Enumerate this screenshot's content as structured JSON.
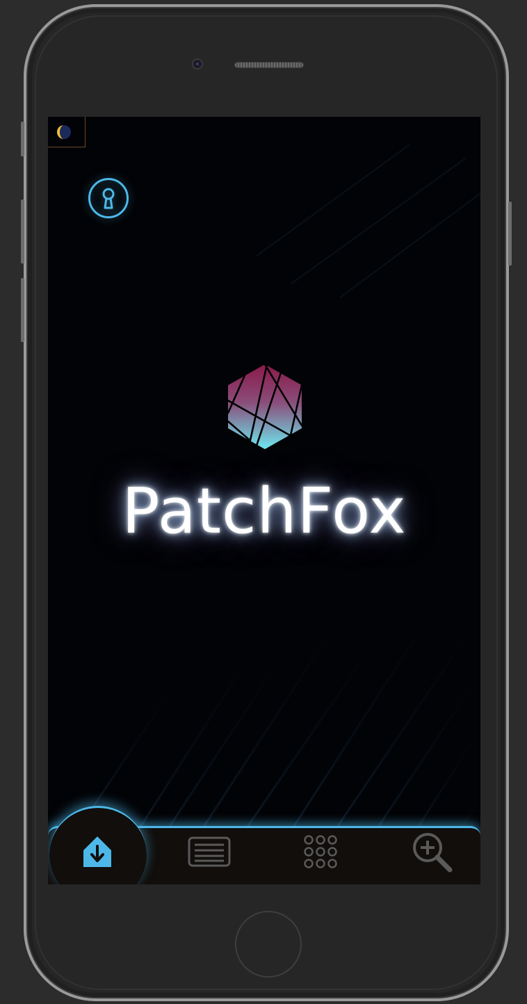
{
  "app": {
    "brand_name": "PatchFox"
  },
  "toolbar": {
    "theme_toggle_icon": "half-moon-icon",
    "lock_icon": "keyhole-icon"
  },
  "tabs": [
    {
      "id": "home",
      "icon": "home-inbox-icon",
      "active": true
    },
    {
      "id": "public",
      "icon": "newspaper-icon",
      "active": false
    },
    {
      "id": "apps",
      "icon": "grid-dots-icon",
      "active": false
    },
    {
      "id": "search",
      "icon": "zoom-in-icon",
      "active": false
    }
  ],
  "colors": {
    "accent": "#4db8e8",
    "logo_top": "#8a1a4a",
    "logo_bottom": "#6ee8f0",
    "screen_bg": "#020306",
    "tabbar_bg": "#110e0c"
  }
}
